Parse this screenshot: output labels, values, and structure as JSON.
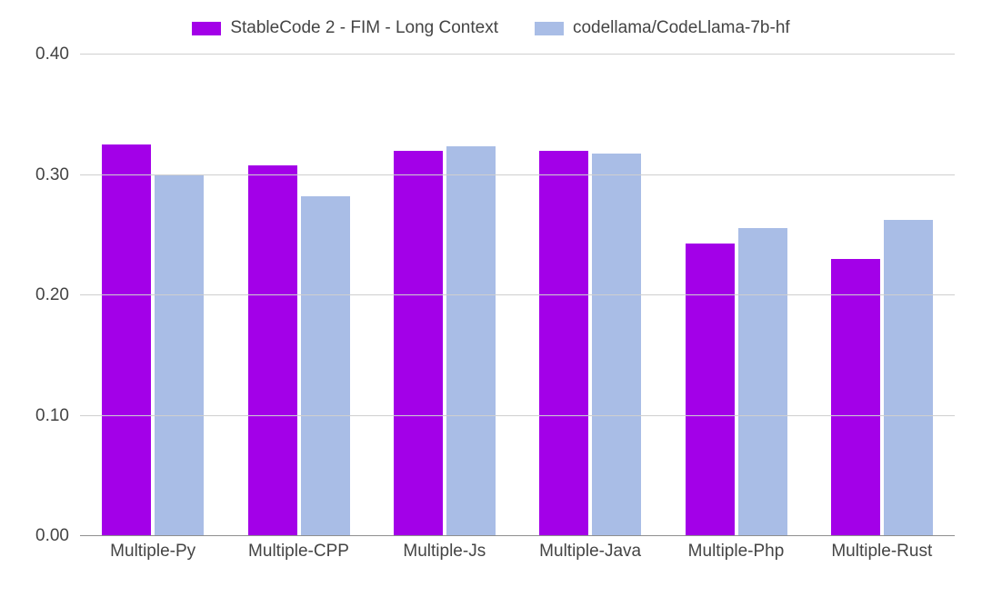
{
  "chart_data": {
    "type": "bar",
    "categories": [
      "Multiple-Py",
      "Multiple-CPP",
      "Multiple-Js",
      "Multiple-Java",
      "Multiple-Php",
      "Multiple-Rust"
    ],
    "series": [
      {
        "name": "StableCode 2 - FIM - Long Context",
        "color": "#a300e8",
        "values": [
          0.325,
          0.308,
          0.32,
          0.32,
          0.243,
          0.23
        ]
      },
      {
        "name": "codellama/CodeLlama-7b-hf",
        "color": "#a9bde6",
        "values": [
          0.3,
          0.282,
          0.324,
          0.318,
          0.256,
          0.263
        ]
      }
    ],
    "title": "",
    "xlabel": "",
    "ylabel": "",
    "ylim": [
      0.0,
      0.4
    ],
    "yticks": [
      0.0,
      0.1,
      0.2,
      0.3,
      0.4
    ],
    "ytick_labels": [
      "0.00",
      "0.10",
      "0.20",
      "0.30",
      "0.40"
    ],
    "grid": true,
    "legend_position": "top"
  }
}
